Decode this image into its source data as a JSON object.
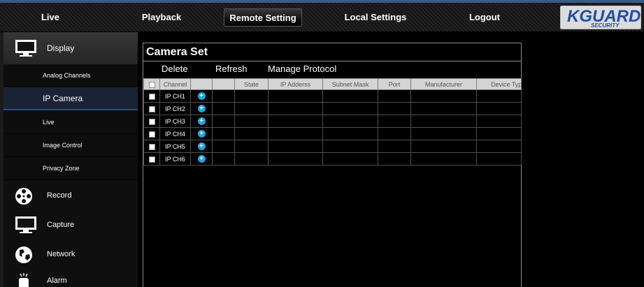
{
  "nav": {
    "items": [
      {
        "label": "Live"
      },
      {
        "label": "Playback"
      },
      {
        "label": "Remote Setting"
      },
      {
        "label": "Local Settings"
      },
      {
        "label": "Logout"
      }
    ],
    "active_index": 2,
    "logo_text": "KGUARD",
    "logo_subtext": "SECURITY"
  },
  "sidebar": {
    "display_label": "Display",
    "subitems": [
      {
        "label": "Analog Channels"
      },
      {
        "label": "IP Camera"
      },
      {
        "label": "Live"
      },
      {
        "label": "Image Control"
      },
      {
        "label": "Privacy Zone"
      }
    ],
    "active_subitem": 1,
    "record_label": "Record",
    "capture_label": "Capture",
    "network_label": "Network",
    "alarm_label": "Alarm"
  },
  "panel": {
    "title": "Camera Set",
    "toolbar": {
      "delete_label": "Delete",
      "refresh_label": "Refresh",
      "manage_protocol_label": "Manage Protocol"
    },
    "columns": [
      "Channel",
      "State",
      "IP Adderss",
      "Subnet Mask",
      "Port",
      "Manufacturer",
      "Device Type"
    ],
    "rows": [
      {
        "channel": "IP CH1"
      },
      {
        "channel": "IP CH2"
      },
      {
        "channel": "IP CH3"
      },
      {
        "channel": "IP CH4"
      },
      {
        "channel": "IP CH5"
      },
      {
        "channel": "IP CH6"
      }
    ]
  },
  "colors": {
    "accent": "#1fa3d6",
    "active_subitem_bg": "#1a2335",
    "logo_blue": "#1f4fa8"
  }
}
